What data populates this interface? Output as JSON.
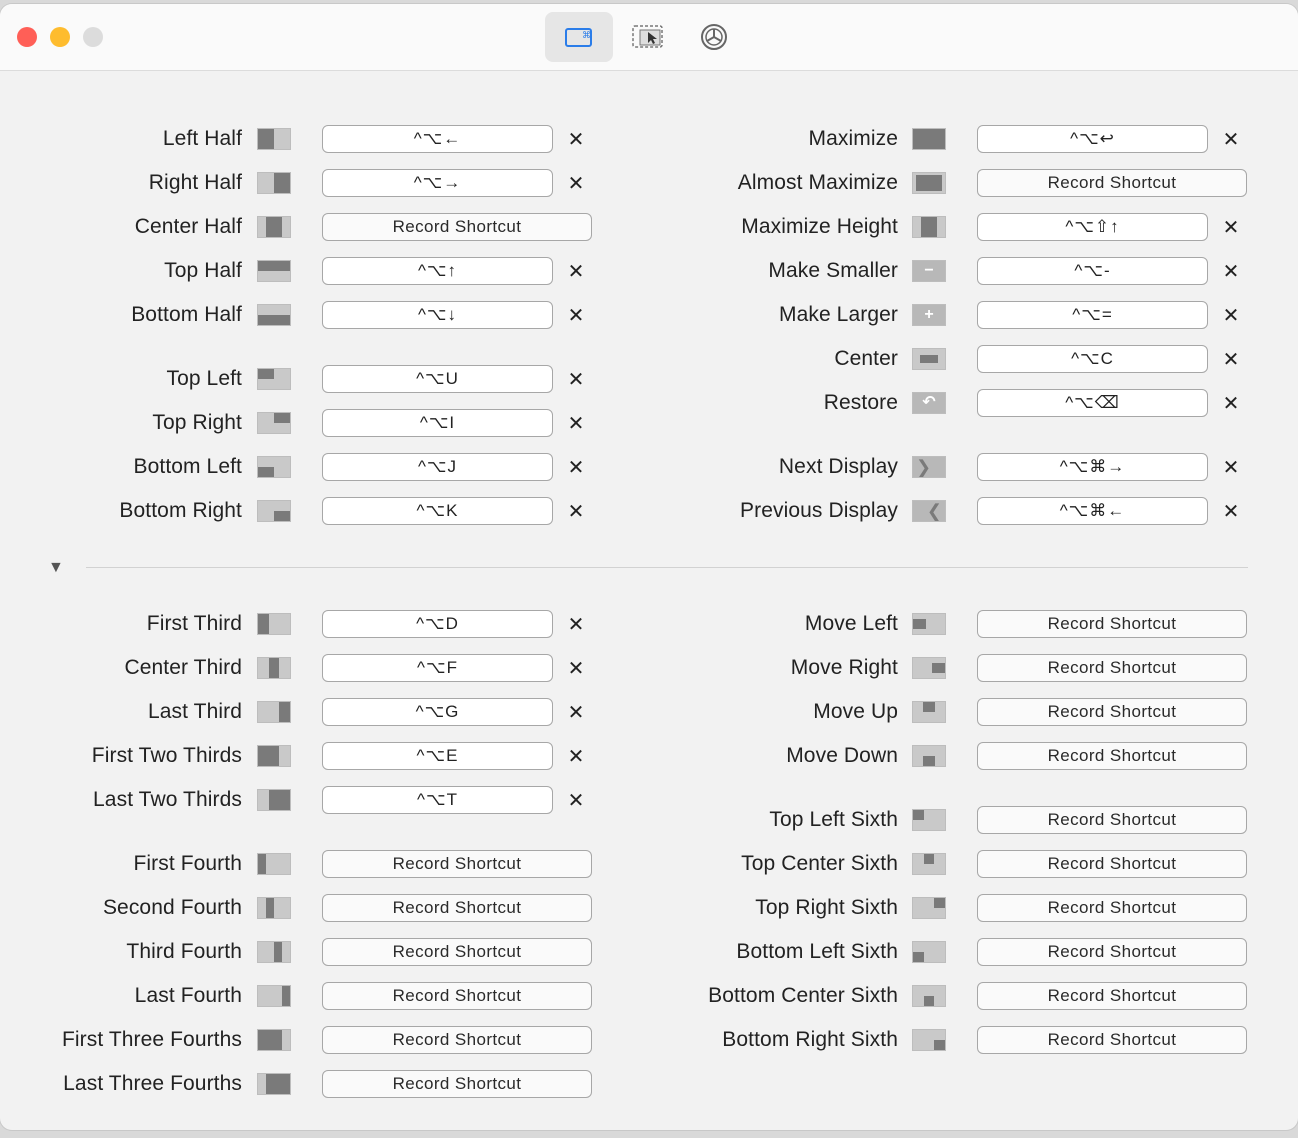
{
  "window": {
    "toolbar": [
      {
        "name": "keyboard-shortcuts-tab",
        "icon": "window-keyboard-icon",
        "active": true
      },
      {
        "name": "snap-areas-tab",
        "icon": "cursor-window-icon",
        "active": false
      },
      {
        "name": "settings-tab",
        "icon": "gear-icon",
        "active": false
      }
    ]
  },
  "left_column": [
    {
      "label": "Left Half",
      "icon": "left-half",
      "shortcut": "^⌥←",
      "recorded": true
    },
    {
      "label": "Right Half",
      "icon": "right-half",
      "shortcut": "^⌥→",
      "recorded": true
    },
    {
      "label": "Center Half",
      "icon": "center-half",
      "shortcut": "Record Shortcut",
      "recorded": false
    },
    {
      "label": "Top Half",
      "icon": "top-half",
      "shortcut": "^⌥↑",
      "recorded": true
    },
    {
      "label": "Bottom Half",
      "icon": "bottom-half",
      "shortcut": "^⌥↓",
      "recorded": true
    },
    {
      "label": "Top Left",
      "icon": "top-left",
      "shortcut": "^⌥U",
      "recorded": true
    },
    {
      "label": "Top Right",
      "icon": "top-right",
      "shortcut": "^⌥I",
      "recorded": true
    },
    {
      "label": "Bottom Left",
      "icon": "bottom-left",
      "shortcut": "^⌥J",
      "recorded": true
    },
    {
      "label": "Bottom Right",
      "icon": "bottom-right",
      "shortcut": "^⌥K",
      "recorded": true
    },
    {
      "label": "First Third",
      "icon": "first-third",
      "shortcut": "^⌥D",
      "recorded": true
    },
    {
      "label": "Center Third",
      "icon": "center-third",
      "shortcut": "^⌥F",
      "recorded": true
    },
    {
      "label": "Last Third",
      "icon": "last-third",
      "shortcut": "^⌥G",
      "recorded": true
    },
    {
      "label": "First Two Thirds",
      "icon": "first-two-thirds",
      "shortcut": "^⌥E",
      "recorded": true
    },
    {
      "label": "Last Two Thirds",
      "icon": "last-two-thirds",
      "shortcut": "^⌥T",
      "recorded": true
    },
    {
      "label": "First Fourth",
      "icon": "first-fourth",
      "shortcut": "Record Shortcut",
      "recorded": false
    },
    {
      "label": "Second Fourth",
      "icon": "second-fourth",
      "shortcut": "Record Shortcut",
      "recorded": false
    },
    {
      "label": "Third Fourth",
      "icon": "third-fourth",
      "shortcut": "Record Shortcut",
      "recorded": false
    },
    {
      "label": "Last Fourth",
      "icon": "last-fourth",
      "shortcut": "Record Shortcut",
      "recorded": false
    },
    {
      "label": "First Three Fourths",
      "icon": "first-three-fourths",
      "shortcut": "Record Shortcut",
      "recorded": false
    },
    {
      "label": "Last Three Fourths",
      "icon": "last-three-fourths",
      "shortcut": "Record Shortcut",
      "recorded": false
    }
  ],
  "right_column": [
    {
      "label": "Maximize",
      "icon": "maximize",
      "shortcut": "^⌥↩",
      "recorded": true
    },
    {
      "label": "Almost Maximize",
      "icon": "almost-maximize",
      "shortcut": "Record Shortcut",
      "recorded": false
    },
    {
      "label": "Maximize Height",
      "icon": "maximize-height",
      "shortcut": "^⌥⇧↑",
      "recorded": true
    },
    {
      "label": "Make Smaller",
      "icon": "make-smaller",
      "shortcut": "^⌥-",
      "recorded": true
    },
    {
      "label": "Make Larger",
      "icon": "make-larger",
      "shortcut": "^⌥=",
      "recorded": true
    },
    {
      "label": "Center",
      "icon": "center",
      "shortcut": "^⌥C",
      "recorded": true
    },
    {
      "label": "Restore",
      "icon": "restore",
      "shortcut": "^⌥⌫",
      "recorded": true
    },
    {
      "label": "Next Display",
      "icon": "next-display",
      "shortcut": "^⌥⌘→",
      "recorded": true
    },
    {
      "label": "Previous Display",
      "icon": "previous-display",
      "shortcut": "^⌥⌘←",
      "recorded": true
    },
    {
      "label": "Move Left",
      "icon": "move-left",
      "shortcut": "Record Shortcut",
      "recorded": false
    },
    {
      "label": "Move Right",
      "icon": "move-right",
      "shortcut": "Record Shortcut",
      "recorded": false
    },
    {
      "label": "Move Up",
      "icon": "move-up",
      "shortcut": "Record Shortcut",
      "recorded": false
    },
    {
      "label": "Move Down",
      "icon": "move-down",
      "shortcut": "Record Shortcut",
      "recorded": false
    },
    {
      "label": "Top Left Sixth",
      "icon": "top-left-sixth",
      "shortcut": "Record Shortcut",
      "recorded": false
    },
    {
      "label": "Top Center Sixth",
      "icon": "top-center-sixth",
      "shortcut": "Record Shortcut",
      "recorded": false
    },
    {
      "label": "Top Right Sixth",
      "icon": "top-right-sixth",
      "shortcut": "Record Shortcut",
      "recorded": false
    },
    {
      "label": "Bottom Left Sixth",
      "icon": "bottom-left-sixth",
      "shortcut": "Record Shortcut",
      "recorded": false
    },
    {
      "label": "Bottom Center Sixth",
      "icon": "bottom-center-sixth",
      "shortcut": "Record Shortcut",
      "recorded": false
    },
    {
      "label": "Bottom Right Sixth",
      "icon": "bottom-right-sixth",
      "shortcut": "Record Shortcut",
      "recorded": false
    }
  ],
  "colors": {
    "accent": "#3b82f6",
    "traffic_red": "#ff5f57",
    "traffic_yellow": "#febc2e",
    "traffic_gray": "#dcdcdc"
  }
}
